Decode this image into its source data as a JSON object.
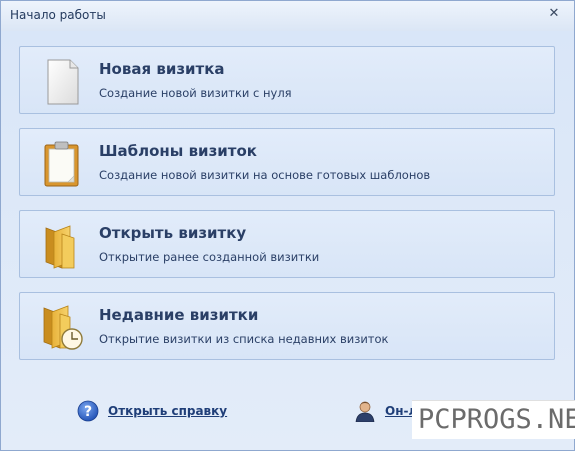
{
  "window": {
    "title": "Начало работы",
    "close_glyph": "✕"
  },
  "cards": [
    {
      "title": "Новая визитка",
      "desc": "Создание новой визитки с нуля",
      "icon": "blank-document-icon"
    },
    {
      "title": "Шаблоны визиток",
      "desc": "Создание новой визитки на основе готовых шаблонов",
      "icon": "clipboard-template-icon"
    },
    {
      "title": "Открыть визитку",
      "desc": "Открытие ранее созданной визитки",
      "icon": "open-folder-icon"
    },
    {
      "title": "Недавние визитки",
      "desc": "Открытие визитки из списка недавних визиток",
      "icon": "recent-folder-clock-icon"
    }
  ],
  "footer": {
    "help_label": "Открыть справку",
    "online_label": "Он-лайн"
  },
  "watermark": {
    "text": "PCPROGS.NET"
  },
  "colors": {
    "accent_text": "#2a3f66",
    "link": "#1f3e78",
    "card_border": "#a9c0e0",
    "background": "#dfe9f8"
  }
}
